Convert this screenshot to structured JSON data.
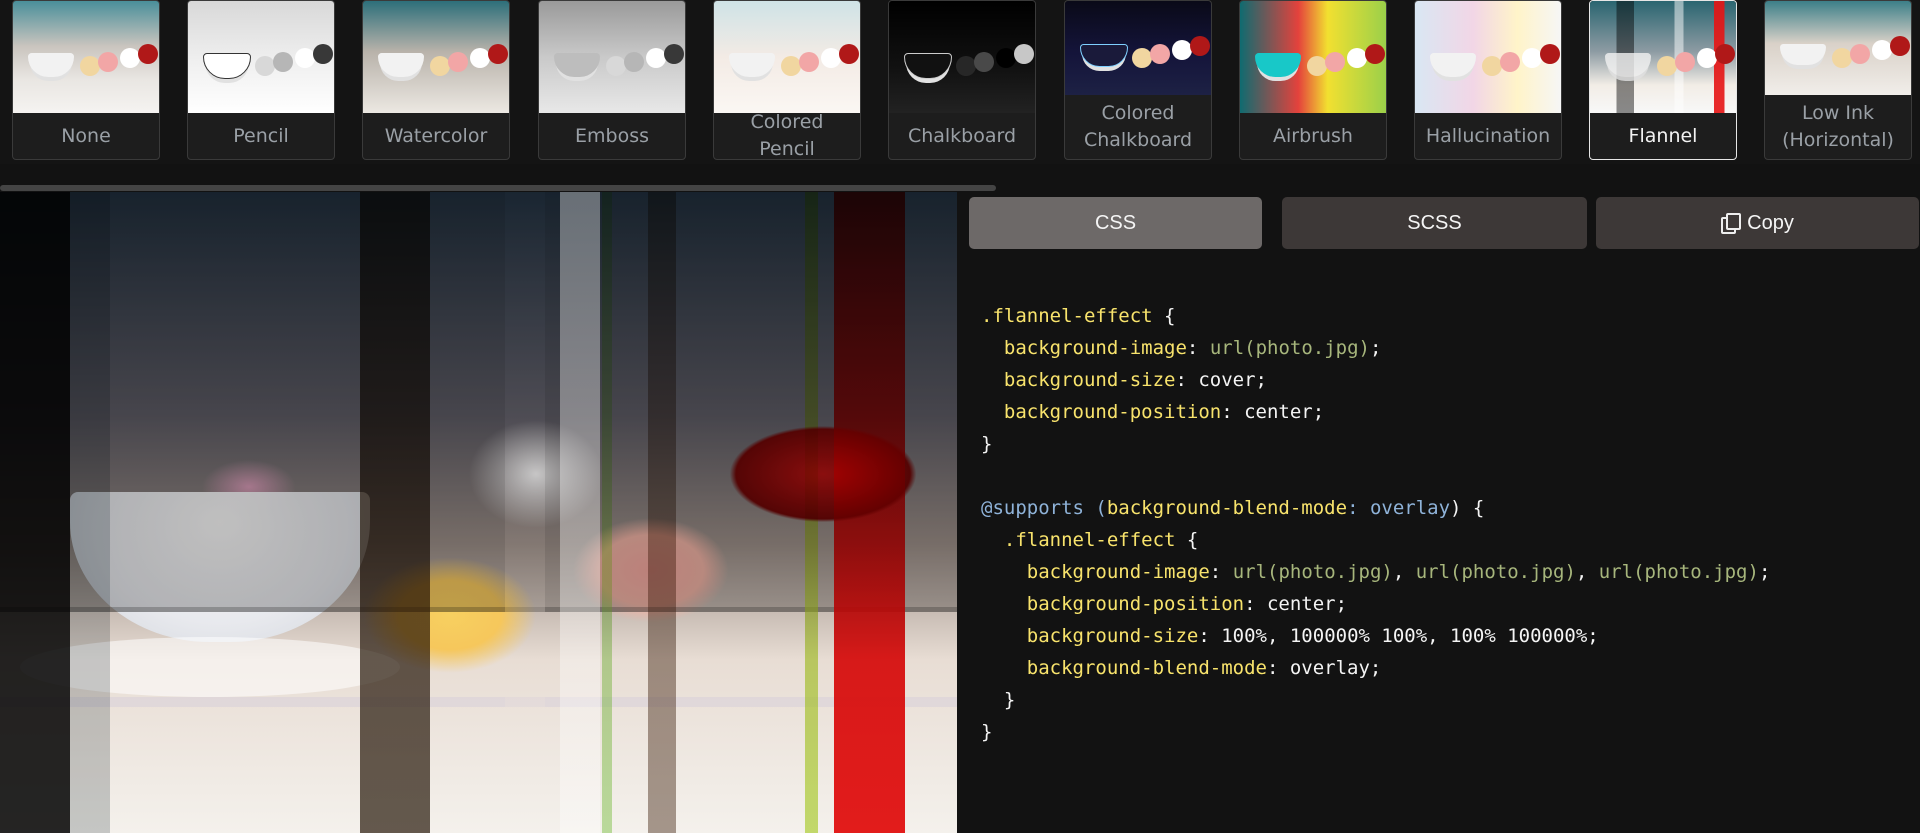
{
  "filters": [
    {
      "label": "None",
      "thumb": "t-none"
    },
    {
      "label": "Pencil",
      "thumb": "t-pencil"
    },
    {
      "label": "Watercolor",
      "thumb": "t-water"
    },
    {
      "label": "Emboss",
      "thumb": "t-emboss"
    },
    {
      "label": "Colored Pencil",
      "thumb": "t-cpencil"
    },
    {
      "label": "Chalkboard",
      "thumb": "t-chalk"
    },
    {
      "label": "Colored Chalkboard",
      "thumb": "t-cchalk"
    },
    {
      "label": "Airbrush",
      "thumb": "t-airbrush"
    },
    {
      "label": "Hallucination",
      "thumb": "t-halluc"
    },
    {
      "label": "Flannel",
      "thumb": "t-flannel",
      "active": true
    },
    {
      "label": "Low Ink (Horizontal)",
      "thumb": "t-lowink"
    }
  ],
  "tabs": {
    "css": "CSS",
    "scss": "SCSS",
    "copy": "Copy"
  },
  "code": {
    "l1_sel": ".flannel-effect",
    "l1_brace": " {",
    "l2_prop": "background-image",
    "l2_colon": ": ",
    "l2_url": "url(photo.jpg)",
    "l2_end": ";",
    "l3_prop": "background-size",
    "l3_rest": ": cover;",
    "l4_prop": "background-position",
    "l4_rest": ": center;",
    "l5": "}",
    "l7_at": "@supports",
    "l7_open": " (",
    "l7_prop": "background-blend-mode",
    "l7_colon": ": ",
    "l7_val": "overlay",
    "l7_close": ") {",
    "l8_sel": ".flannel-effect",
    "l8_brace": " {",
    "l9_prop": "background-image",
    "l9_colon": ": ",
    "l9_url1": "url(photo.jpg)",
    "l9_sep1": ", ",
    "l9_url2": "url(photo.jpg)",
    "l9_sep2": ", ",
    "l9_url3": "url(photo.jpg)",
    "l9_end": ";",
    "l10_prop": "background-position",
    "l10_rest": ": center;",
    "l11_prop": "background-size",
    "l11_rest": ": 100%, 100000% 100%, 100% 100000%;",
    "l12_prop": "background-blend-mode",
    "l12_rest": ": overlay;",
    "l13": "  }",
    "l14": "}"
  }
}
